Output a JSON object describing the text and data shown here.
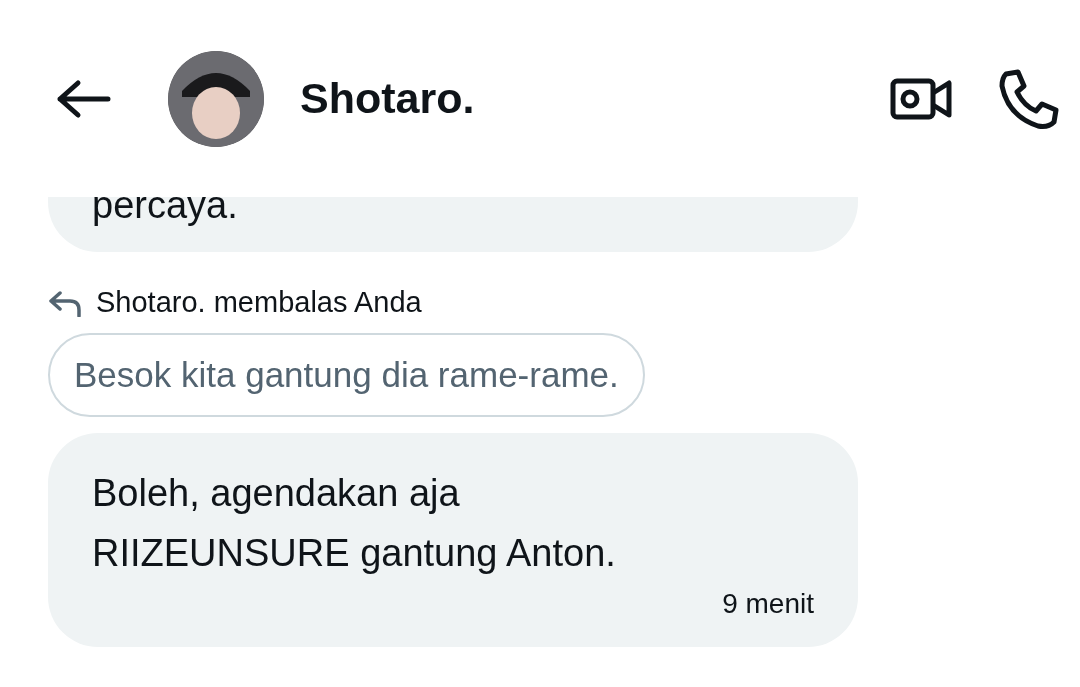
{
  "header": {
    "title": "Shotaro."
  },
  "messages": [
    {
      "kind": "bubble",
      "lines": [
        "percaya."
      ]
    },
    {
      "kind": "reply",
      "label": "Shotaro. membalas Anda",
      "quote": "Besok kita gantung dia rame-rame."
    },
    {
      "kind": "bubble",
      "lines": [
        "Boleh, agendakan aja",
        "RIIZEUNSURE gantung Anton."
      ],
      "time": "9 menit"
    }
  ]
}
